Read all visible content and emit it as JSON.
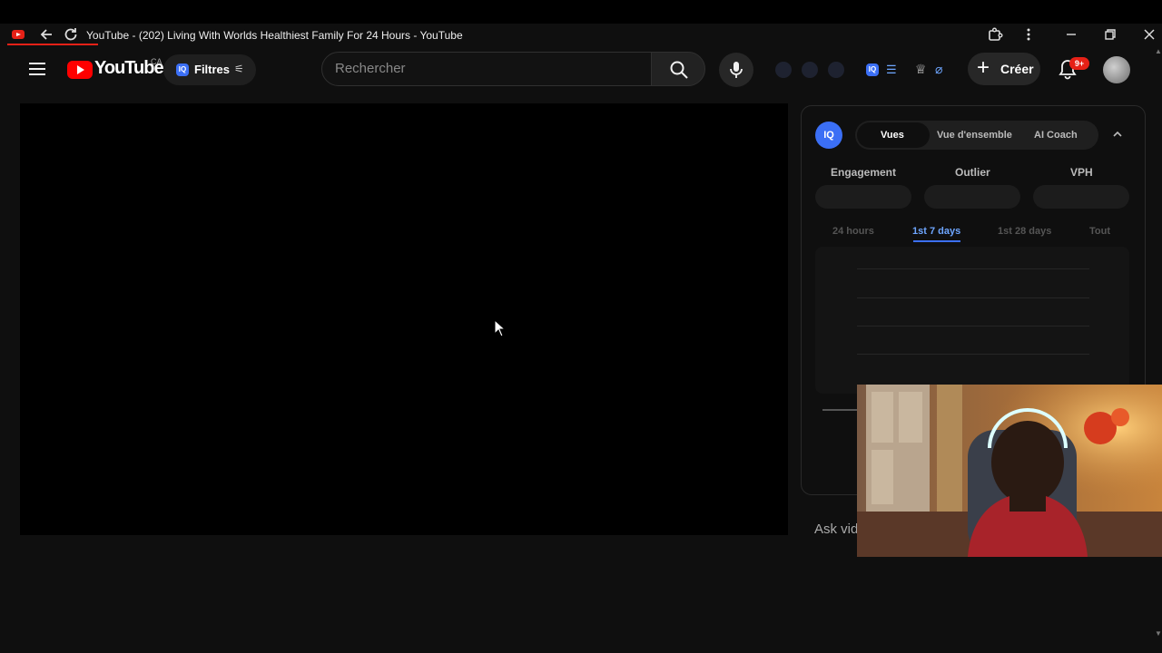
{
  "browser": {
    "title": "YouTube - (202) Living With Worlds Healthiest Family For 24 Hours - YouTube"
  },
  "masthead": {
    "logo_text": "YouTube",
    "country_code": "CA",
    "filters_label": "Filtres",
    "search_placeholder": "Rechercher",
    "create_label": "Créer",
    "notification_count": "9+"
  },
  "panel": {
    "badge": "IQ",
    "tabs": [
      "Vues",
      "Vue d'ensemble",
      "AI Coach"
    ],
    "active_tab": "Vues",
    "metrics": [
      "Engagement",
      "Outlier",
      "VPH"
    ],
    "ranges": [
      "24 hours",
      "1st 7 days",
      "1st 28 days",
      "Tout"
    ],
    "selected_range": "1st 7 days",
    "ask_text": "Ask vid"
  },
  "colors": {
    "accent_red": "#ff0000",
    "iq_blue": "#3b6ff5",
    "range_selected": "#6ea6ff"
  },
  "icons": [
    "back-icon",
    "reload-icon",
    "extensions-icon",
    "menu-dots-icon",
    "minimize-icon",
    "restore-icon",
    "close-icon",
    "hamburger-icon",
    "search-icon",
    "mic-icon",
    "bell-icon",
    "chevron-up-icon"
  ]
}
